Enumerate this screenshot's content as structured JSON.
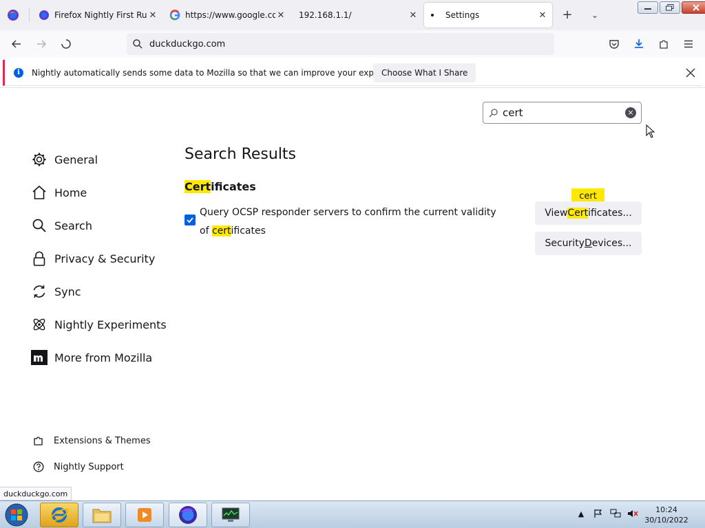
{
  "tabs": [
    {
      "title": "Firefox Nightly First Run P",
      "close": "✕"
    },
    {
      "title": "https://www.google.com",
      "close": "✕"
    },
    {
      "title": "192.168.1.1/",
      "close": "✕"
    },
    {
      "title": "Settings",
      "close": "✕"
    }
  ],
  "toolbar": {
    "new_tab": "+",
    "list_tabs": "⌄"
  },
  "urlbar": {
    "value": "duckduckgo.com"
  },
  "notification": {
    "message": "Nightly automatically sends some data to Mozilla so that we can improve your experience.",
    "button": "Choose What I Share",
    "close": "✕"
  },
  "search": {
    "value": "cert",
    "clear": "×"
  },
  "sidebar": {
    "items": [
      {
        "label": "General",
        "icon": "gear-icon"
      },
      {
        "label": "Home",
        "icon": "home-icon"
      },
      {
        "label": "Search",
        "icon": "search-icon"
      },
      {
        "label": "Privacy & Security",
        "icon": "lock-icon"
      },
      {
        "label": "Sync",
        "icon": "sync-icon"
      },
      {
        "label": "Nightly Experiments",
        "icon": "experiments-icon"
      },
      {
        "label": "More from Mozilla",
        "icon": "mozilla-icon"
      }
    ],
    "footer": [
      {
        "label": "Extensions & Themes",
        "icon": "puzzle-icon"
      },
      {
        "label": "Nightly Support",
        "icon": "help-icon"
      }
    ]
  },
  "main": {
    "title": "Search Results",
    "section": {
      "title_hl": "Cert",
      "title_rest": "ificates"
    },
    "ocsp": {
      "text": "Query OCSP responder servers to confirm the current validity of ",
      "hl": "cert",
      "rest": "ificates",
      "checked": true
    },
    "view_btn": {
      "pre": "View ",
      "hl": "Cert",
      "rest": "ificates..."
    },
    "devices_btn": {
      "pre": "Security ",
      "ul": "D",
      "rest": "evices..."
    },
    "badge": "cert"
  },
  "status_url": "duckduckgo.com",
  "clock": {
    "time": "10:24",
    "date": "30/10/2022"
  },
  "colors": {
    "accent": "#0060df",
    "highlight": "#ffe900",
    "notification_stripe": "#e22850"
  }
}
